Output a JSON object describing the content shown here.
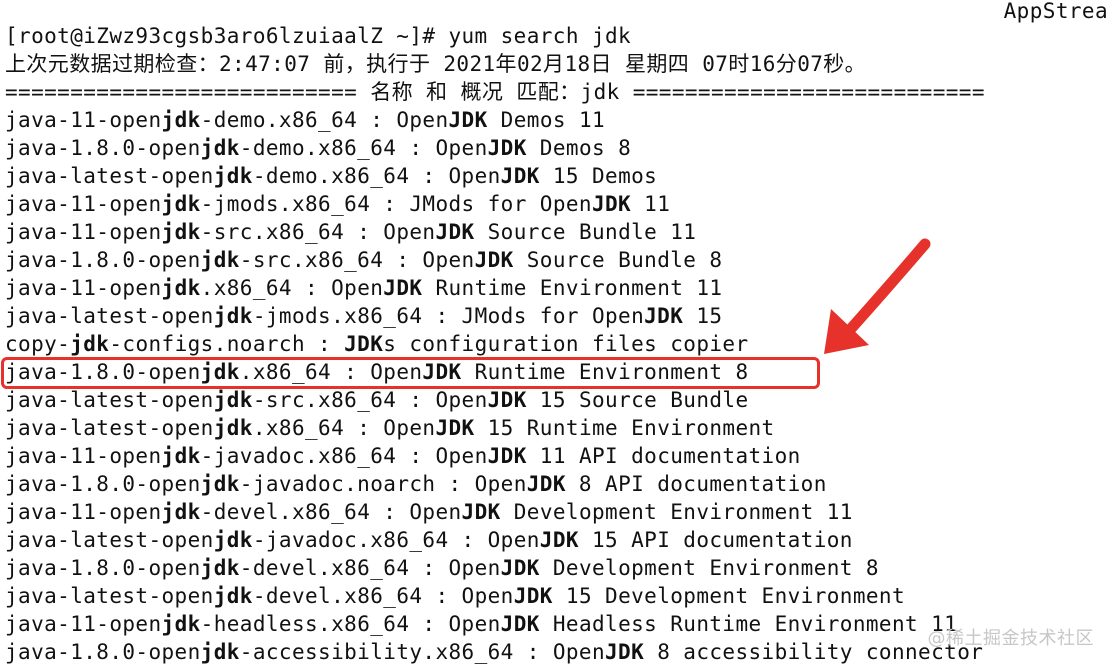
{
  "terminal": {
    "top_right_text": "AppStrea",
    "prompt_line": "[root@iZwz93cgsb3aro6lzuiaalZ ~]# yum search jdk",
    "metadata_line": "上次元数据过期检查：2:47:07 前，执行于 2021年02月18日 星期四 07时16分07秒。",
    "separator_line": "=========================== 名称 和 概况 匹配：jdk ===========================",
    "results": [
      {
        "pre": "java-11-open",
        "bold": "jdk",
        "post": "-demo.x86_64 : Open",
        "bold2": "JDK",
        "post2": " Demos 11"
      },
      {
        "pre": "java-1.8.0-open",
        "bold": "jdk",
        "post": "-demo.x86_64 : Open",
        "bold2": "JDK",
        "post2": " Demos 8"
      },
      {
        "pre": "java-latest-open",
        "bold": "jdk",
        "post": "-demo.x86_64 : Open",
        "bold2": "JDK",
        "post2": " 15 Demos"
      },
      {
        "pre": "java-11-open",
        "bold": "jdk",
        "post": "-jmods.x86_64 : JMods for Open",
        "bold2": "JDK",
        "post2": " 11"
      },
      {
        "pre": "java-11-open",
        "bold": "jdk",
        "post": "-src.x86_64 : Open",
        "bold2": "JDK",
        "post2": " Source Bundle 11"
      },
      {
        "pre": "java-1.8.0-open",
        "bold": "jdk",
        "post": "-src.x86_64 : Open",
        "bold2": "JDK",
        "post2": " Source Bundle 8"
      },
      {
        "pre": "java-11-open",
        "bold": "jdk",
        "post": ".x86_64 : Open",
        "bold2": "JDK",
        "post2": " Runtime Environment 11"
      },
      {
        "pre": "java-latest-open",
        "bold": "jdk",
        "post": "-jmods.x86_64 : JMods for Open",
        "bold2": "JDK",
        "post2": " 15"
      },
      {
        "pre": "copy-",
        "bold": "jdk",
        "post": "-configs.noarch : ",
        "bold2": "JDK",
        "post2": "s configuration files copier"
      },
      {
        "pre": "java-1.8.0-open",
        "bold": "jdk",
        "post": ".x86_64 : Open",
        "bold2": "JDK",
        "post2": " Runtime Environment 8"
      },
      {
        "pre": "java-latest-open",
        "bold": "jdk",
        "post": "-src.x86_64 : Open",
        "bold2": "JDK",
        "post2": " 15 Source Bundle"
      },
      {
        "pre": "java-latest-open",
        "bold": "jdk",
        "post": ".x86_64 : Open",
        "bold2": "JDK",
        "post2": " 15 Runtime Environment"
      },
      {
        "pre": "java-11-open",
        "bold": "jdk",
        "post": "-javadoc.x86_64 : Open",
        "bold2": "JDK",
        "post2": " 11 API documentation"
      },
      {
        "pre": "java-1.8.0-open",
        "bold": "jdk",
        "post": "-javadoc.noarch : Open",
        "bold2": "JDK",
        "post2": " 8 API documentation"
      },
      {
        "pre": "java-11-open",
        "bold": "jdk",
        "post": "-devel.x86_64 : Open",
        "bold2": "JDK",
        "post2": " Development Environment 11"
      },
      {
        "pre": "java-latest-open",
        "bold": "jdk",
        "post": "-javadoc.x86_64 : Open",
        "bold2": "JDK",
        "post2": " 15 API documentation"
      },
      {
        "pre": "java-1.8.0-open",
        "bold": "jdk",
        "post": "-devel.x86_64 : Open",
        "bold2": "JDK",
        "post2": " Development Environment 8"
      },
      {
        "pre": "java-latest-open",
        "bold": "jdk",
        "post": "-devel.x86_64 : Open",
        "bold2": "JDK",
        "post2": " 15 Development Environment"
      },
      {
        "pre": "java-11-open",
        "bold": "jdk",
        "post": "-headless.x86_64 : Open",
        "bold2": "JDK",
        "post2": " Headless Runtime Environment 11"
      },
      {
        "pre": "java-1.8.0-open",
        "bold": "jdk",
        "post": "-accessibility.x86_64 : Open",
        "bold2": "JDK",
        "post2": " 8 accessibility connector"
      }
    ],
    "highlight": {
      "row_index": 9,
      "color": "#e7312b"
    },
    "watermark": "@稀土掘金技术社区"
  }
}
